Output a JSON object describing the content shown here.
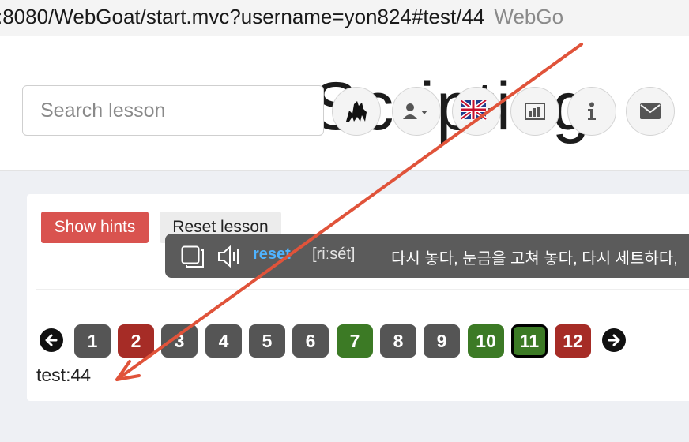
{
  "browser": {
    "url": ":8080/WebGoat/start.mvc?username=yon824#test/44",
    "tab_partial_title": "WebGo"
  },
  "header": {
    "background_title": "Scripting",
    "search_placeholder": "Search lesson",
    "icons": [
      "webgoat-logo-icon",
      "user-icon",
      "language-flag-icon",
      "report-card-icon",
      "info-icon",
      "mail-icon"
    ]
  },
  "lesson": {
    "show_hints_label": "Show hints",
    "reset_lesson_label": "Reset lesson"
  },
  "dictionary_popup": {
    "word": "reset",
    "pronunciation": "[riːsét]",
    "definition": "다시 놓다, 눈금을 고쳐 놓다, 다시 세트하다,"
  },
  "pagination": {
    "pages": [
      {
        "label": "1",
        "status": "gray"
      },
      {
        "label": "2",
        "status": "red"
      },
      {
        "label": "3",
        "status": "gray"
      },
      {
        "label": "4",
        "status": "gray"
      },
      {
        "label": "5",
        "status": "gray"
      },
      {
        "label": "6",
        "status": "gray"
      },
      {
        "label": "7",
        "status": "green"
      },
      {
        "label": "8",
        "status": "gray"
      },
      {
        "label": "9",
        "status": "gray"
      },
      {
        "label": "10",
        "status": "green"
      },
      {
        "label": "11",
        "status": "green",
        "current": true
      },
      {
        "label": "12",
        "status": "red"
      }
    ],
    "status_text": "test:44"
  },
  "colors": {
    "danger": "#d9534f",
    "page_gray": "#555555",
    "page_red": "#a62c26",
    "page_green": "#3c7a25",
    "annotation": "#e0533a",
    "dict_word": "#4fb3ff"
  }
}
